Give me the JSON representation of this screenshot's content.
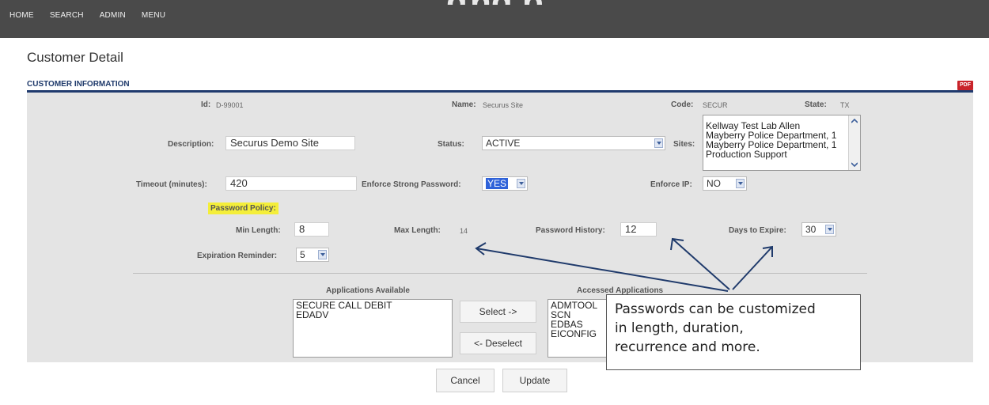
{
  "nav": {
    "home": "HOME",
    "search": "SEARCH",
    "admin": "ADMIN",
    "menu": "MENU"
  },
  "page": {
    "title": "Customer Detail",
    "section_title": "CUSTOMER INFORMATION",
    "pdf_label": "PDF"
  },
  "customer": {
    "id_label": "Id:",
    "id_value": "D-99001",
    "name_label": "Name:",
    "name_value": "Securus Site",
    "code_label": "Code:",
    "code_value": "SECUR",
    "state_label": "State:",
    "state_value": "TX",
    "description_label": "Description:",
    "description_value": "Securus Demo Site",
    "status_label": "Status:",
    "status_value": "ACTIVE",
    "sites_label": "Sites:",
    "sites": [
      "Kellway Test Lab Allen",
      "Mayberry Police Department, 1",
      "Mayberry Police Department, 1",
      "Production Support"
    ],
    "timeout_label": "Timeout (minutes):",
    "timeout_value": "420",
    "strong_password_label": "Enforce Strong Password:",
    "strong_password_value": "YES",
    "enforce_ip_label": "Enforce IP:",
    "enforce_ip_value": "NO"
  },
  "password_policy": {
    "title": "Password Policy:",
    "min_length_label": "Min Length:",
    "min_length_value": "8",
    "max_length_label": "Max Length:",
    "max_length_value": "14",
    "history_label": "Password History:",
    "history_value": "12",
    "days_expire_label": "Days to Expire:",
    "days_expire_value": "30",
    "reminder_label": "Expiration Reminder:",
    "reminder_value": "5"
  },
  "applications": {
    "available_label": "Applications Available",
    "available": [
      "SECURE CALL DEBIT",
      "EDADV"
    ],
    "accessed_label": "Accessed Applications",
    "accessed": [
      "ADMTOOL",
      "SCN",
      "EDBAS",
      "EICONFIG"
    ],
    "select_label": "Select ->",
    "deselect_label": "<- Deselect"
  },
  "buttons": {
    "cancel": "Cancel",
    "update": "Update"
  },
  "callout": {
    "line1": "Passwords can be customized",
    "line2": "in length, duration,",
    "line3": "recurrence and more."
  },
  "colors": {
    "header_bg": "#4a4a4a",
    "panel_bg": "#e4e4e4",
    "section_rule": "#203a6e",
    "highlight": "#f4ee3a",
    "pdf": "#c9232a"
  }
}
